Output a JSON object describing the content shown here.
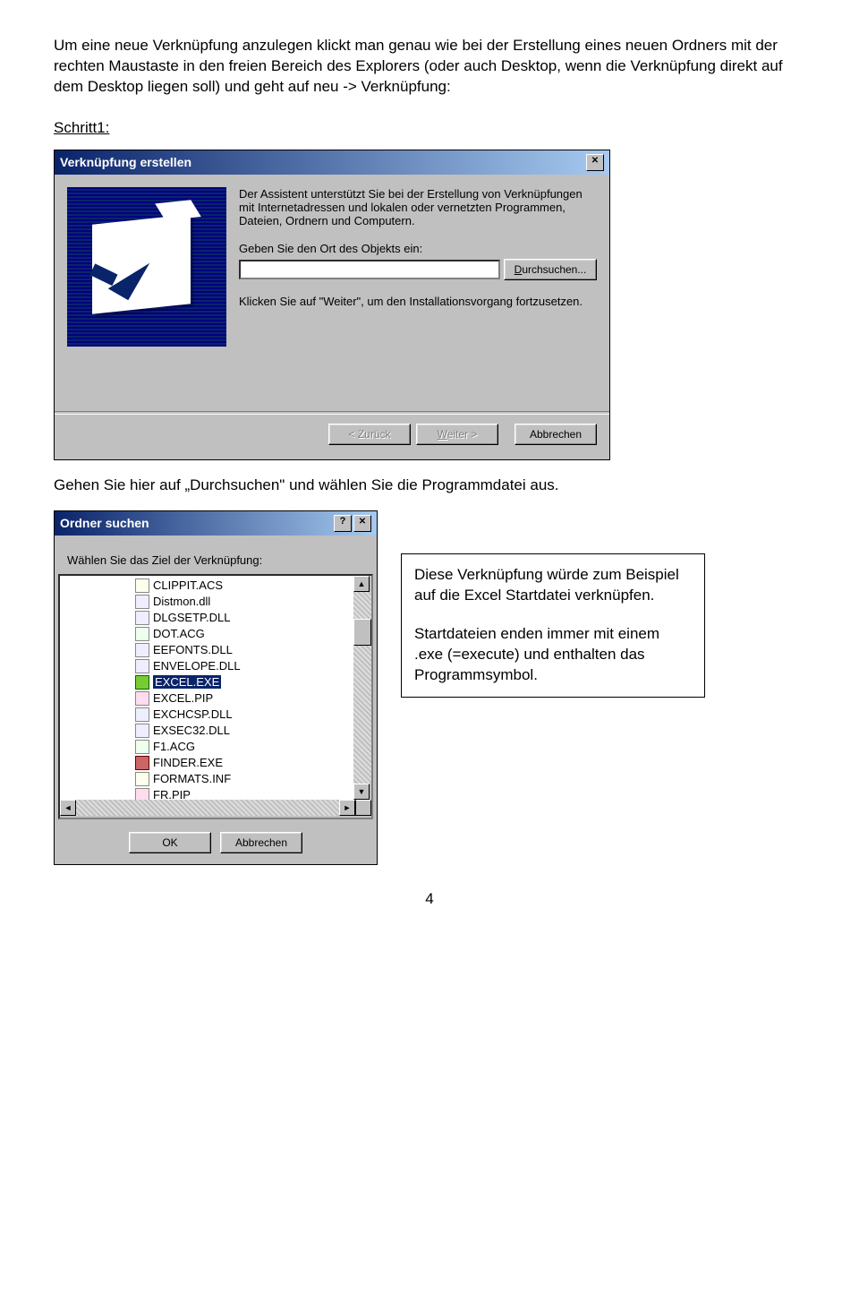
{
  "intro": "Um eine neue Verknüpfung anzulegen klickt man genau wie bei der Erstellung eines neuen Ordners mit der rechten Maustaste in den freien Bereich des Explorers (oder auch Desktop, wenn die Verknüpfung direkt auf dem Desktop liegen soll) und geht auf neu -> Verknüpfung:",
  "step_label": "Schritt1:",
  "wizard": {
    "title": "Verknüpfung erstellen",
    "desc": "Der Assistent unterstützt Sie bei der Erstellung von Verknüpfungen mit Internetadressen und lokalen oder vernetzten Programmen, Dateien, Ordnern und Computern.",
    "path_label": "Geben Sie den Ort des Objekts ein:",
    "path_value": "",
    "browse": "Durchsuchen...",
    "continue_label": "Klicken Sie auf \"Weiter\", um den Installationsvorgang fortzusetzen.",
    "back": "< Zurück",
    "next": "Weiter >",
    "cancel": "Abbrechen"
  },
  "between": "Gehen Sie hier auf „Durchsuchen\" und wählen Sie die Programmdatei aus.",
  "browse_dialog": {
    "title": "Ordner suchen",
    "prompt": "Wählen Sie das Ziel der Verknüpfung:",
    "items": [
      {
        "icon": "clip",
        "name": "CLIPPIT.ACS"
      },
      {
        "icon": "dll",
        "name": "Distmon.dll"
      },
      {
        "icon": "dll",
        "name": "DLGSETP.DLL"
      },
      {
        "icon": "acg",
        "name": "DOT.ACG"
      },
      {
        "icon": "dll",
        "name": "EEFONTS.DLL"
      },
      {
        "icon": "dll",
        "name": "ENVELOPE.DLL"
      },
      {
        "icon": "exe",
        "name": "EXCEL.EXE",
        "selected": true
      },
      {
        "icon": "pip",
        "name": "EXCEL.PIP"
      },
      {
        "icon": "dll",
        "name": "EXCHCSP.DLL"
      },
      {
        "icon": "dll",
        "name": "EXSEC32.DLL"
      },
      {
        "icon": "acg",
        "name": "F1.ACG"
      },
      {
        "icon": "exe2",
        "name": "FINDER.EXE"
      },
      {
        "icon": "inf",
        "name": "FORMATS.INF"
      },
      {
        "icon": "pip",
        "name": "FR.PIP"
      }
    ],
    "ok": "OK",
    "cancel": "Abbrechen"
  },
  "note": {
    "p1": "Diese Verknüpfung würde zum Beispiel auf die Excel Startdatei verknüpfen.",
    "p2": "Startdateien enden immer mit einem .exe (=execute) und enthalten das Programmsymbol."
  },
  "page_number": "4"
}
